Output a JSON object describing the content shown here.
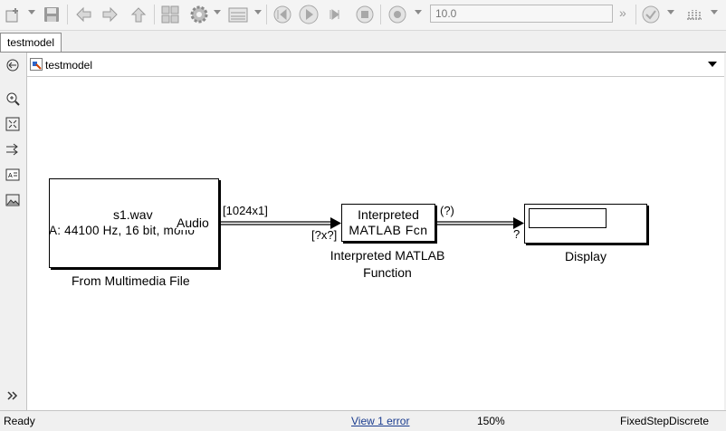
{
  "toolbar": {
    "stop_time": "10.0",
    "stop_time_chevron": "»",
    "icons": [
      "new-model-icon",
      "save-icon",
      "back-icon",
      "forward-icon",
      "up-icon",
      "library-icon",
      "settings-gear-icon",
      "explorer-icon",
      "step-back-icon",
      "run-icon",
      "step-forward-icon",
      "stop-icon",
      "record-icon",
      "check-icon",
      "build-icon"
    ]
  },
  "tab": {
    "label": "testmodel"
  },
  "address": {
    "path": "testmodel"
  },
  "diagram": {
    "from_file": {
      "line1": "s1.wav",
      "line2": "A: 44100 Hz, 16 bit, mono",
      "port": "Audio",
      "caption": "From Multimedia File"
    },
    "signal1": {
      "dims": "[1024x1]",
      "input_dims": "[?x?]"
    },
    "interp": {
      "line1": "Interpreted",
      "line2": "MATLAB Fcn",
      "caption_line1": "Interpreted MATLAB",
      "caption_line2": "Function",
      "out_dims": "(?)"
    },
    "display": {
      "input_dims": "?",
      "caption": "Display"
    }
  },
  "status": {
    "state": "Ready",
    "error_link": "View 1 error",
    "zoom": "150%",
    "solver": "FixedStepDiscrete"
  }
}
